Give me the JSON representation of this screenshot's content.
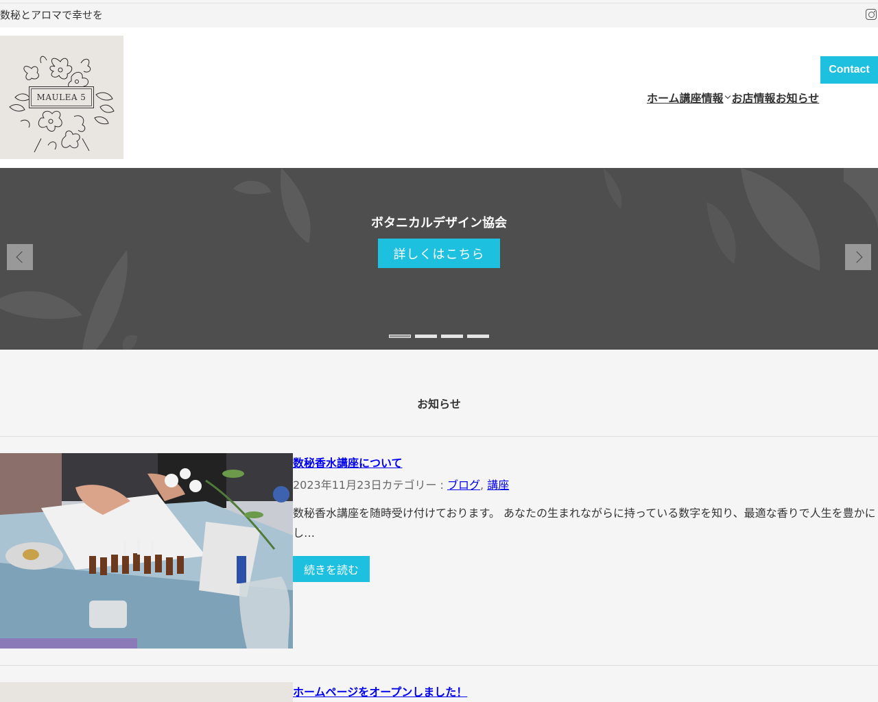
{
  "topbar": {
    "tagline": "数秘とアロマで幸せを",
    "social_icon": "instagram-icon"
  },
  "header": {
    "logo_text": "MAULEA 5",
    "nav": [
      {
        "label": "ホーム"
      },
      {
        "label": "講座情報",
        "has_dropdown": true
      },
      {
        "label": "お店情報"
      },
      {
        "label": "お知らせ"
      }
    ],
    "contact_label": "Contact"
  },
  "hero": {
    "title": "ボタニカルデザイン協会",
    "button_label": "詳しくはこちら",
    "slide_count": 4,
    "active_slide": 1,
    "prev_icon": "chevron-left-icon",
    "next_icon": "chevron-right-icon"
  },
  "news": {
    "section_title": "お知らせ",
    "posts": [
      {
        "title": "数秘香水講座について",
        "date": "2023年11月23日",
        "category_prefix": "カテゴリー : ",
        "categories": [
          "ブログ",
          "講座"
        ],
        "excerpt": "数秘香水講座を随時受け付けております。 あなたの生まれながらに持っている数字を知り、最適な香りで人生を豊かにし…",
        "read_more": "続きを読む"
      },
      {
        "title": "ホームページをオープンしました！"
      }
    ]
  },
  "colors": {
    "accent": "#1ec0e0",
    "hero_bg": "#4e4e4e",
    "link": "#0000ee"
  }
}
